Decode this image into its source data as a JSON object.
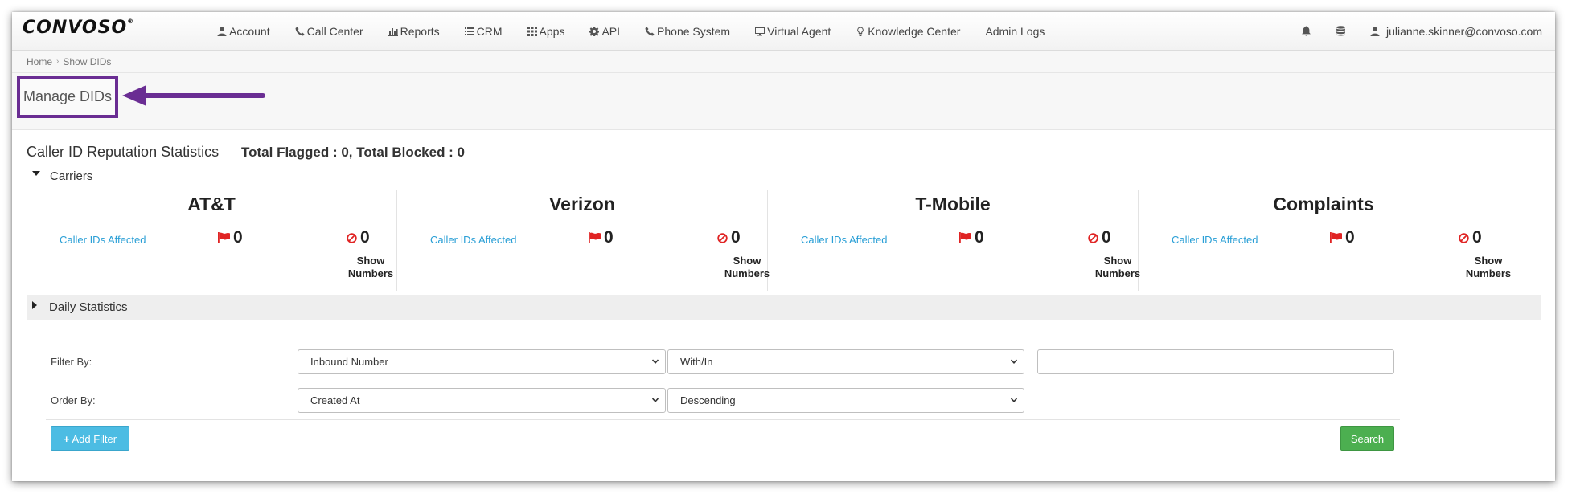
{
  "brand": {
    "logo": "CONVOSO",
    "trademark": "®"
  },
  "nav": {
    "items": [
      {
        "label": "Account",
        "icon": "user-icon"
      },
      {
        "label": "Call Center",
        "icon": "phone-icon"
      },
      {
        "label": "Reports",
        "icon": "bar-chart-icon"
      },
      {
        "label": "CRM",
        "icon": "list-icon"
      },
      {
        "label": "Apps",
        "icon": "grid-icon"
      },
      {
        "label": "API",
        "icon": "gear-icon"
      },
      {
        "label": "Phone System",
        "icon": "phone-icon"
      },
      {
        "label": "Virtual Agent",
        "icon": "monitor-icon"
      },
      {
        "label": "Knowledge Center",
        "icon": "lightbulb-icon"
      },
      {
        "label": "Admin Logs",
        "icon": ""
      }
    ],
    "user_email": "julianne.skinner@convoso.com"
  },
  "breadcrumb": {
    "home": "Home",
    "current": "Show DIDs"
  },
  "page": {
    "title": "Manage DIDs"
  },
  "stats": {
    "heading": "Caller ID Reputation Statistics",
    "totals": "Total Flagged : 0, Total Blocked : 0",
    "carriers_label": "Carriers",
    "daily_label": "Daily Statistics",
    "carriers": [
      {
        "name": "AT&T",
        "affected_label": "Caller IDs Affected",
        "flagged": "0",
        "blocked": "0",
        "show_numbers": "Show Numbers"
      },
      {
        "name": "Verizon",
        "affected_label": "Caller IDs Affected",
        "flagged": "0",
        "blocked": "0",
        "show_numbers": "Show Numbers"
      },
      {
        "name": "T-Mobile",
        "affected_label": "Caller IDs Affected",
        "flagged": "0",
        "blocked": "0",
        "show_numbers": "Show Numbers"
      },
      {
        "name": "Complaints",
        "affected_label": "Caller IDs Affected",
        "flagged": "0",
        "blocked": "0",
        "show_numbers": "Show Numbers"
      }
    ]
  },
  "filter": {
    "filter_by_label": "Filter By:",
    "order_by_label": "Order By:",
    "filter_field": "Inbound Number",
    "filter_operator": "With/In",
    "filter_value": "",
    "order_field": "Created At",
    "order_direction": "Descending",
    "add_filter_label": "Add Filter",
    "search_label": "Search"
  },
  "colors": {
    "accent_link": "#2a9fd6",
    "highlight_border": "#6a2d93",
    "add_button": "#4cbce3",
    "search_button": "#4caf50",
    "flag": "#e02424"
  }
}
